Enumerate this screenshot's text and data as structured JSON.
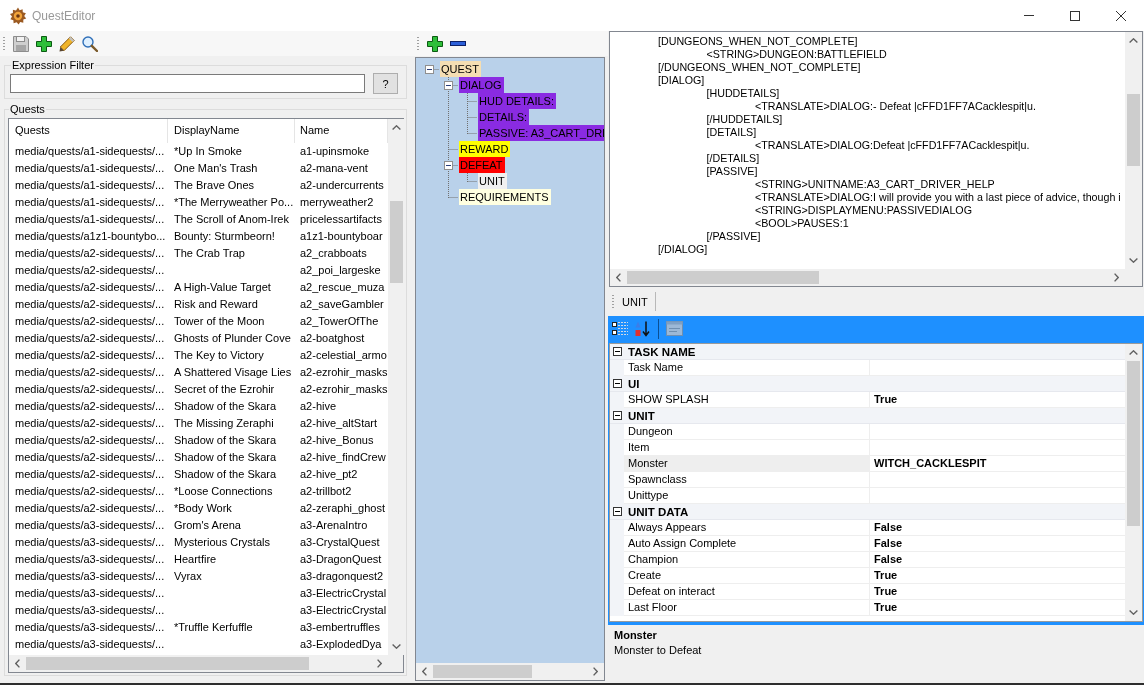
{
  "window": {
    "title": "QuestEditor"
  },
  "quest_toolbar": [
    {
      "kind": "save",
      "disabled": true
    },
    {
      "kind": "add",
      "disabled": false
    },
    {
      "kind": "edit",
      "disabled": false
    },
    {
      "kind": "search",
      "disabled": false
    }
  ],
  "filter": {
    "label": "Expression Filter",
    "help_button": "?"
  },
  "quests": {
    "label": "Quests",
    "columns": [
      "Quests",
      "DisplayName",
      "Name"
    ],
    "rows": [
      {
        "path": "media/quests/a1-sidequests/...",
        "display_name": "*Up In Smoke",
        "name": "a1-upinsmoke"
      },
      {
        "path": "media/quests/a1-sidequests/...",
        "display_name": "One Man's Trash",
        "name": "a2-mana-vent"
      },
      {
        "path": "media/quests/a1-sidequests/...",
        "display_name": "The Brave Ones",
        "name": "a2-undercurrents"
      },
      {
        "path": "media/quests/a1-sidequests/...",
        "display_name": "*The Merryweather Po...",
        "name": "merryweather2"
      },
      {
        "path": "media/quests/a1-sidequests/...",
        "display_name": "The Scroll of Anom-Irek",
        "name": "pricelessartifacts"
      },
      {
        "path": "media/quests/a1z1-bountybo...",
        "display_name": "Bounty: Sturmbeorn!",
        "name": "a1z1-bountyboar"
      },
      {
        "path": "media/quests/a2-sidequests/...",
        "display_name": "The Crab Trap",
        "name": "a2_crabboats"
      },
      {
        "path": "media/quests/a2-sidequests/...",
        "name": "a2_poi_largeske"
      },
      {
        "path": "media/quests/a2-sidequests/...",
        "display_name": "A High-Value Target",
        "name": "a2_rescue_muza"
      },
      {
        "path": "media/quests/a2-sidequests/...",
        "display_name": "Risk and Reward",
        "name": "a2_saveGambler"
      },
      {
        "path": "media/quests/a2-sidequests/...",
        "display_name": "Tower of the Moon",
        "name": "a2_TowerOfThe"
      },
      {
        "path": "media/quests/a2-sidequests/...",
        "display_name": "Ghosts of Plunder Cove",
        "name": "a2-boatghost"
      },
      {
        "path": "media/quests/a2-sidequests/...",
        "display_name": "The Key to Victory",
        "name": "a2-celestial_armo"
      },
      {
        "path": "media/quests/a2-sidequests/...",
        "display_name": "A Shattered Visage Lies",
        "name": "a2-ezrohir_masks"
      },
      {
        "path": "media/quests/a2-sidequests/...",
        "display_name": "Secret of the Ezrohir",
        "name": "a2-ezrohir_masks"
      },
      {
        "path": "media/quests/a2-sidequests/...",
        "display_name": "Shadow of the Skara",
        "name": "a2-hive"
      },
      {
        "path": "media/quests/a2-sidequests/...",
        "display_name": "The Missing Zeraphi",
        "name": "a2-hive_altStart"
      },
      {
        "path": "media/quests/a2-sidequests/...",
        "display_name": "Shadow of the Skara",
        "name": "a2-hive_Bonus"
      },
      {
        "path": "media/quests/a2-sidequests/...",
        "display_name": "Shadow of the Skara",
        "name": "a2-hive_findCrew"
      },
      {
        "path": "media/quests/a2-sidequests/...",
        "display_name": "Shadow of the Skara",
        "name": "a2-hive_pt2"
      },
      {
        "path": "media/quests/a2-sidequests/...",
        "display_name": "*Loose Connections",
        "name": "a2-trillbot2"
      },
      {
        "path": "media/quests/a2-sidequests/...",
        "display_name": "*Body Work",
        "name": "a2-zeraphi_ghost"
      },
      {
        "path": "media/quests/a3-sidequests/...",
        "display_name": "Grom's Arena",
        "name": "a3-ArenaIntro"
      },
      {
        "path": "media/quests/a3-sidequests/...",
        "display_name": "Mysterious Crystals",
        "name": "a3-CrystalQuest"
      },
      {
        "path": "media/quests/a3-sidequests/...",
        "display_name": "Heartfire",
        "name": "a3-DragonQuest"
      },
      {
        "path": "media/quests/a3-sidequests/...",
        "display_name": "Vyrax",
        "name": "a3-dragonquest2"
      },
      {
        "path": "media/quests/a3-sidequests/...",
        "name": "a3-ElectricCrystal"
      },
      {
        "path": "media/quests/a3-sidequests/...",
        "name": "a3-ElectricCrystal"
      },
      {
        "path": "media/quests/a3-sidequests/...",
        "display_name": "*Truffle Kerfuffle",
        "name": "a3-embertruffles"
      },
      {
        "path": "media/quests/a3-sidequests/...",
        "name": "a3-ExplodedDya"
      }
    ]
  },
  "tree_toolbar": [
    {
      "kind": "add",
      "disabled": false
    },
    {
      "kind": "remove",
      "disabled": false
    }
  ],
  "tree": {
    "nodes": [
      {
        "label": "QUEST",
        "color": "#f5deb3",
        "selected": false,
        "expanded": true,
        "children": [
          {
            "label": "DIALOG",
            "color": "#8a2be2",
            "selected": false,
            "expanded": true,
            "children": [
              {
                "label": "HUD DETAILS:",
                "color": "#8a2be2",
                "selected": false
              },
              {
                "label": "DETAILS:",
                "color": "#8a2be2",
                "selected": false
              },
              {
                "label": "PASSIVE: A3_CART_DRI",
                "color": "#8a2be2",
                "selected": false
              }
            ]
          },
          {
            "label": "REWARD",
            "color": "#ffff00",
            "selected": false
          },
          {
            "label": "DEFEAT",
            "color": "#ff0000",
            "selected": false,
            "expanded": true,
            "children": [
              {
                "label": "UNIT",
                "selected": true
              }
            ]
          },
          {
            "label": "REQUIREMENTS",
            "color": "#ffffe0",
            "selected": false
          }
        ]
      }
    ]
  },
  "script": {
    "lines": [
      {
        "text": "[DUNGEONS_WHEN_NOT_COMPLETE]",
        "children": [
          {
            "text": "<STRING>DUNGEON:BATTLEFIELD"
          }
        ]
      },
      {
        "text": "[/DUNGEONS_WHEN_NOT_COMPLETE]"
      },
      {
        "text": "[DIALOG]",
        "children": [
          {
            "text": "[HUDDETAILS]",
            "children": [
              {
                "text": "<TRANSLATE>DIALOG:- Defeat |cFFD1FF7ACacklespit|u."
              }
            ]
          },
          {
            "text": "[/HUDDETAILS]"
          },
          {
            "text": "[DETAILS]",
            "children": [
              {
                "text": "<TRANSLATE>DIALOG:Defeat |cFFD1FF7ACacklespit|u."
              }
            ]
          },
          {
            "text": "[/DETAILS]"
          },
          {
            "text": "[PASSIVE]",
            "children": [
              {
                "text": "<STRING>UNITNAME:A3_CART_DRIVER_HELP"
              },
              {
                "text": "<TRANSLATE>DIALOG:I will provide you with a last piece of advice, though i"
              },
              {
                "text": "<STRING>DISPLAYMENU:PASSIVEDIALOG"
              },
              {
                "text": "<BOOL>PAUSES:1"
              }
            ]
          },
          {
            "text": "[/PASSIVE]"
          }
        ]
      },
      {
        "text": "[/DIALOG]"
      }
    ]
  },
  "property_panel": {
    "header": "UNIT",
    "toolbar": [
      {
        "kind": "categorized",
        "disabled": false
      },
      {
        "kind": "alphabetical",
        "disabled": false
      },
      {
        "kind": "property-pages",
        "disabled": true
      }
    ],
    "categories": [
      {
        "name": "TASK NAME",
        "expanded": true,
        "properties": [
          {
            "name": "Task Name",
            "selected": false
          }
        ]
      },
      {
        "name": "UI",
        "expanded": true,
        "properties": [
          {
            "name": "SHOW SPLASH",
            "value": "True",
            "selected": false
          }
        ]
      },
      {
        "name": "UNIT",
        "expanded": true,
        "properties": [
          {
            "name": "Dungeon",
            "selected": false
          },
          {
            "name": "Item",
            "selected": false
          },
          {
            "name": "Monster",
            "value": "WITCH_CACKLESPIT",
            "selected": true
          },
          {
            "name": "Spawnclass",
            "selected": false
          },
          {
            "name": "Unittype",
            "selected": false
          }
        ]
      },
      {
        "name": "UNIT DATA",
        "expanded": true,
        "properties": [
          {
            "name": "Always Appears",
            "value": "False",
            "selected": false
          },
          {
            "name": "Auto Assign Complete",
            "value": "False",
            "selected": false
          },
          {
            "name": "Champion",
            "value": "False",
            "selected": false
          },
          {
            "name": "Create",
            "value": "True",
            "selected": false
          },
          {
            "name": "Defeat on interact",
            "value": "True",
            "selected": false
          },
          {
            "name": "Last Floor",
            "value": "True",
            "selected": false
          }
        ]
      }
    ],
    "help": {
      "title": "Monster",
      "description": "Monster to Defeat"
    }
  }
}
